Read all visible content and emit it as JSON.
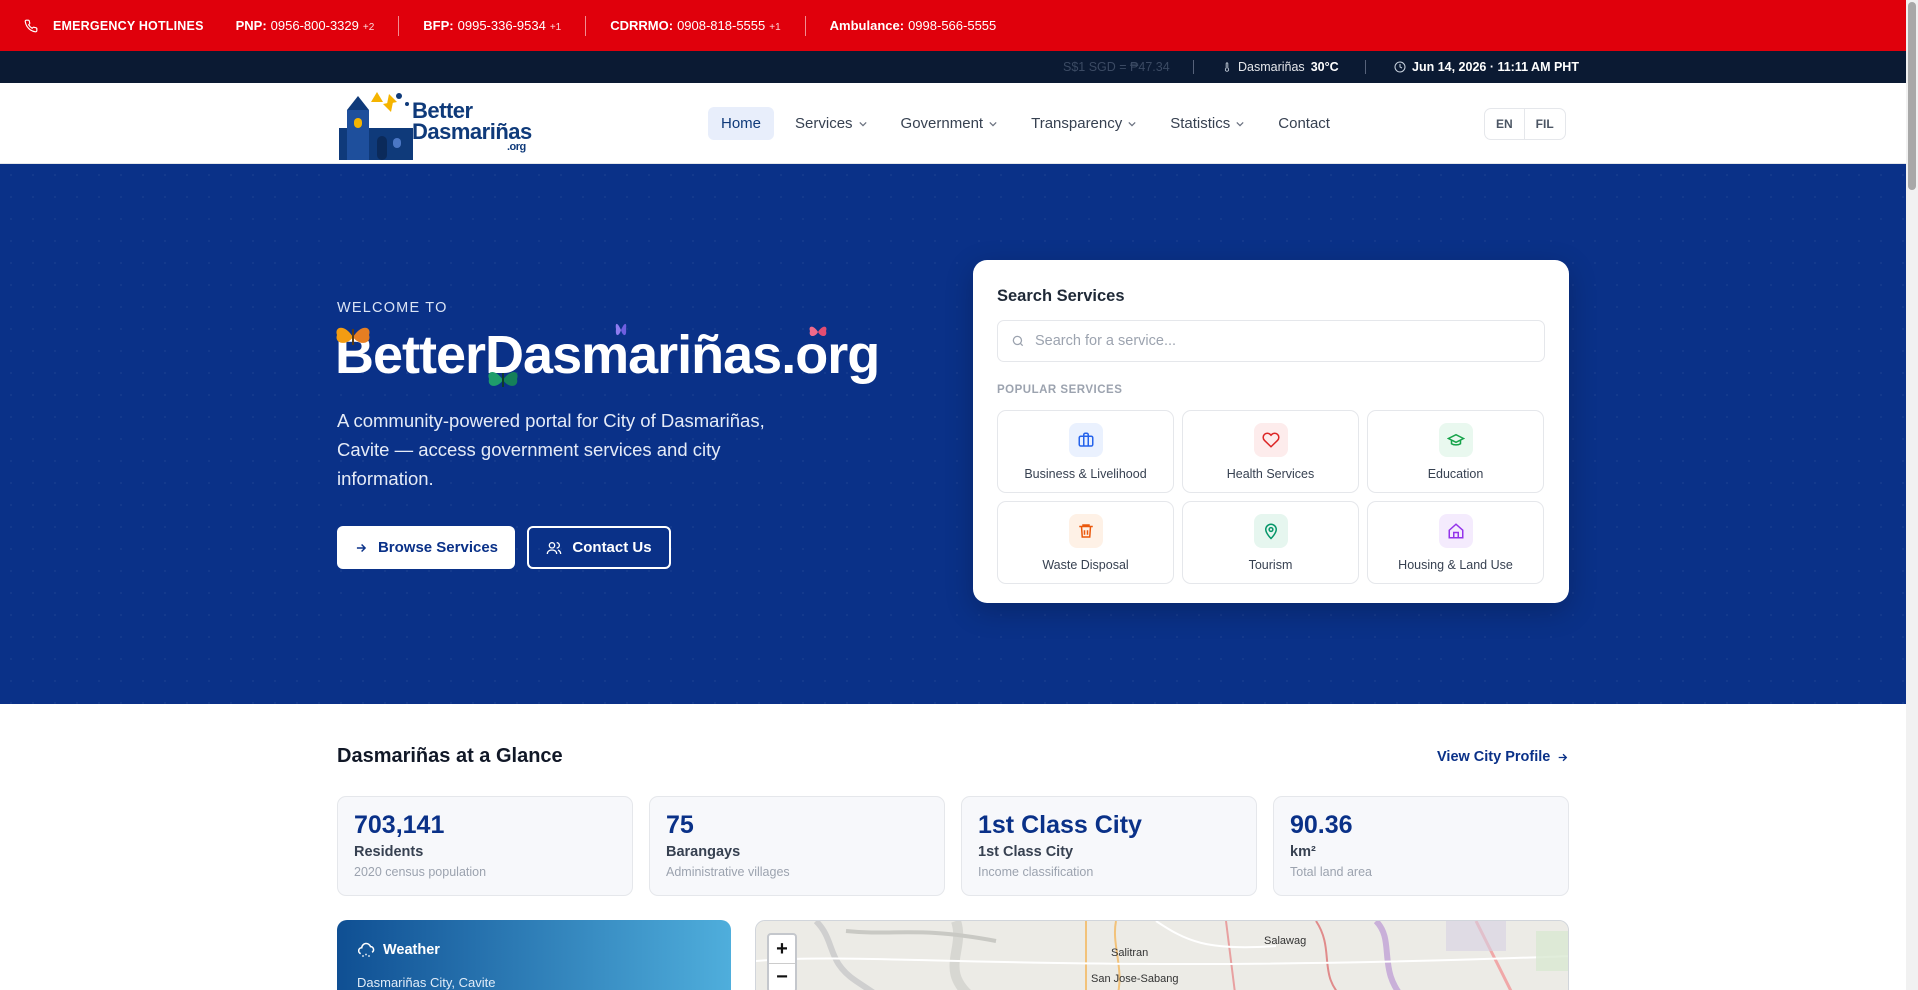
{
  "emergency": {
    "title": "EMERGENCY HOTLINES",
    "hotlines": [
      {
        "name": "PNP:",
        "number": "0956-800-3329",
        "more": "+2"
      },
      {
        "name": "BFP:",
        "number": "0995-336-9534",
        "more": "+1"
      },
      {
        "name": "CDRRMO:",
        "number": "0908-818-5555",
        "more": "+1"
      },
      {
        "name": "Ambulance:",
        "number": "0998-566-5555",
        "more": ""
      }
    ]
  },
  "infobar": {
    "exchange": "S$1 SGD = ₱47.34",
    "location": "Dasmariñas",
    "temperature": "30°C",
    "datetime": "Jun 14, 2026 · 11:11 AM PHT"
  },
  "nav": {
    "logo_line1": "Better",
    "logo_line2": "Dasmariñas",
    "logo_line3": ".org",
    "items": [
      {
        "label": "Home",
        "active": true
      },
      {
        "label": "Services",
        "dropdown": true
      },
      {
        "label": "Government",
        "dropdown": true
      },
      {
        "label": "Transparency",
        "dropdown": true
      },
      {
        "label": "Statistics",
        "dropdown": true
      },
      {
        "label": "Contact"
      }
    ],
    "lang": [
      "EN",
      "FIL"
    ]
  },
  "hero": {
    "welcome": "WELCOME TO",
    "title": "BetterDasmariñas.org",
    "description": "A community-powered portal for City of Dasmariñas, Cavite — access government services and city information.",
    "browse_label": "Browse Services",
    "contact_label": "Contact Us"
  },
  "search": {
    "title": "Search Services",
    "placeholder": "Search for a service...",
    "popular_label": "POPULAR SERVICES",
    "services": [
      {
        "label": "Business & Livelihood",
        "icon": "briefcase-icon",
        "color": "#2563eb"
      },
      {
        "label": "Health Services",
        "icon": "heart-icon",
        "color": "#dc2626"
      },
      {
        "label": "Education",
        "icon": "graduation-cap-icon",
        "color": "#16a34a"
      },
      {
        "label": "Waste Disposal",
        "icon": "trash-icon",
        "color": "#ea580c"
      },
      {
        "label": "Tourism",
        "icon": "map-pin-icon",
        "color": "#059669"
      },
      {
        "label": "Housing & Land Use",
        "icon": "home-icon",
        "color": "#9333ea"
      }
    ]
  },
  "glance": {
    "title": "Dasmariñas at a Glance",
    "view_profile": "View City Profile",
    "stats": [
      {
        "value": "703,141",
        "label": "Residents",
        "desc": "2020 census population"
      },
      {
        "value": "75",
        "label": "Barangays",
        "desc": "Administrative villages"
      },
      {
        "value": "1st Class City",
        "label": "1st Class City",
        "desc": "Income classification"
      },
      {
        "value": "90.36",
        "label": "km²",
        "desc": "Total land area"
      }
    ]
  },
  "weather": {
    "title": "Weather",
    "location": "Dasmariñas City, Cavite"
  },
  "map": {
    "zoom_in": "+",
    "zoom_out": "−",
    "labels": [
      "Salitran",
      "Salawag",
      "San Jose-Sabang"
    ]
  }
}
